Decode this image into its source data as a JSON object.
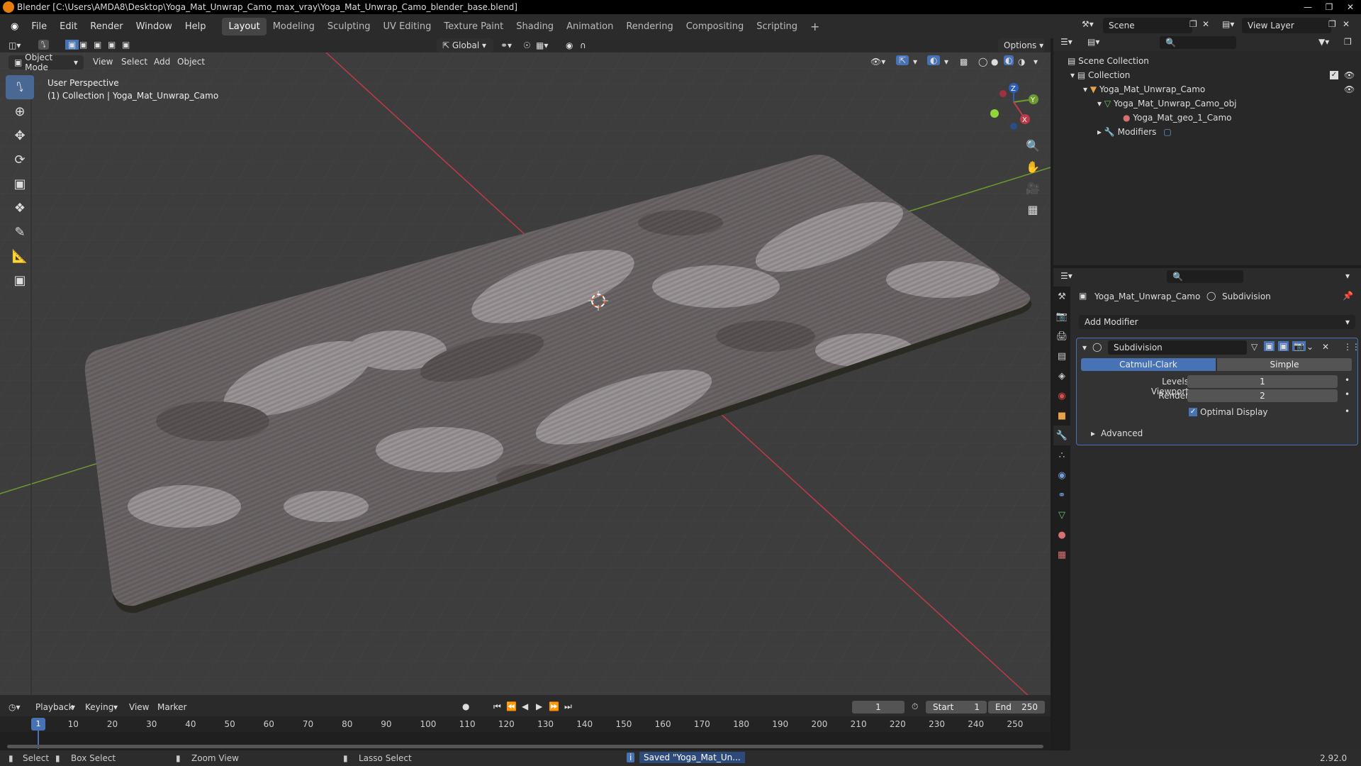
{
  "title": "Blender [C:\\Users\\AMDA8\\Desktop\\Yoga_Mat_Unwrap_Camo_max_vray\\Yoga_Mat_Unwrap_Camo_blender_base.blend]",
  "menu": [
    "File",
    "Edit",
    "Render",
    "Window",
    "Help"
  ],
  "workspaces": [
    "Layout",
    "Modeling",
    "Sculpting",
    "UV Editing",
    "Texture Paint",
    "Shading",
    "Animation",
    "Rendering",
    "Compositing",
    "Scripting"
  ],
  "active_workspace": "Layout",
  "scene": "Scene",
  "view_layer": "View Layer",
  "viewport": {
    "mode": "Object Mode",
    "menus": [
      "View",
      "Select",
      "Add",
      "Object"
    ],
    "transform_orientation": "Global",
    "options": "Options",
    "perspective": "User Perspective",
    "collection_info": "(1) Collection | Yoga_Mat_Unwrap_Camo"
  },
  "gizmo": {
    "z": "Z",
    "y": "Y",
    "x": "X"
  },
  "outliner": {
    "scene_collection": "Scene Collection",
    "collection": "Collection",
    "object": "Yoga_Mat_Unwrap_Camo",
    "mesh": "Yoga_Mat_Unwrap_Camo_obj",
    "material": "Yoga_Mat_geo_1_Camo",
    "modifiers": "Modifiers"
  },
  "properties": {
    "breadcrumb_object": "Yoga_Mat_Unwrap_Camo",
    "breadcrumb_modifier": "Subdivision",
    "add_modifier": "Add Modifier",
    "modifier_name": "Subdivision",
    "mode_catmull": "Catmull-Clark",
    "mode_simple": "Simple",
    "levels_viewport_label": "Levels Viewport",
    "levels_viewport_value": "1",
    "render_label": "Render",
    "render_value": "2",
    "optimal_display": "Optimal Display",
    "optimal_display_checked": true,
    "advanced": "Advanced"
  },
  "timeline": {
    "menus": [
      "Playback",
      "Keying",
      "View",
      "Marker"
    ],
    "current_frame": "1",
    "start_label": "Start",
    "start": "1",
    "end_label": "End",
    "end": "250",
    "ticks": [
      "1",
      "10",
      "20",
      "30",
      "40",
      "50",
      "60",
      "70",
      "80",
      "90",
      "100",
      "110",
      "120",
      "130",
      "140",
      "150",
      "160",
      "170",
      "180",
      "190",
      "200",
      "210",
      "220",
      "230",
      "240",
      "250"
    ]
  },
  "status": {
    "select": "Select",
    "box_select": "Box Select",
    "zoom_view": "Zoom View",
    "lasso_select": "Lasso Select",
    "saved": "Saved \"Yoga_Mat_Un...",
    "version": "2.92.0"
  },
  "colors": {
    "accent": "#4772b3",
    "active_tool": "#4a6894",
    "x_axis": "#c0394b",
    "y_axis": "#6f9a2d",
    "mat_base": "#6b6566",
    "mat_light": "#9a9496"
  }
}
